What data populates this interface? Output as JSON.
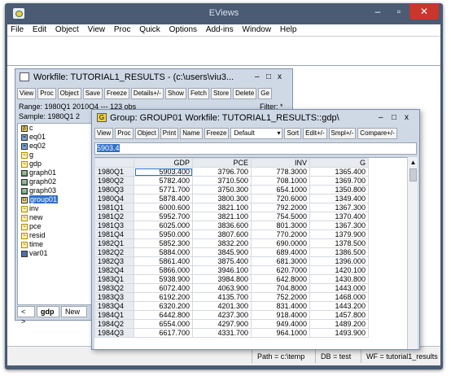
{
  "app": {
    "title": "EViews",
    "window_controls": {
      "minimize": "–",
      "maximize": "▫",
      "close": "✕"
    }
  },
  "menu": [
    "File",
    "Edit",
    "Object",
    "View",
    "Proc",
    "Quick",
    "Options",
    "Add-ins",
    "Window",
    "Help"
  ],
  "workfile_window": {
    "title": "Workfile: TUTORIAL1_RESULTS - (c:\\users\\viu3...",
    "controls": [
      "–",
      "□",
      "x"
    ],
    "toolbar": [
      "View",
      "Proc",
      "Object",
      "Save",
      "Freeze",
      "Details+/-",
      "Show",
      "Fetch",
      "Store",
      "Delete",
      "Ge"
    ],
    "range_label": "Range: 1980Q1 2010Q4  ---  123 obs",
    "range_right": "Filter: *",
    "sample_label": "Sample: 1980Q1 2",
    "objects": [
      {
        "name": "c",
        "icon": "coef-icon"
      },
      {
        "name": "eq01",
        "icon": "equation-icon"
      },
      {
        "name": "eq02",
        "icon": "equation-icon"
      },
      {
        "name": "g",
        "icon": "series-icon"
      },
      {
        "name": "gdp",
        "icon": "series-icon"
      },
      {
        "name": "graph01",
        "icon": "graph-icon"
      },
      {
        "name": "graph02",
        "icon": "graph-icon"
      },
      {
        "name": "graph03",
        "icon": "graph-icon"
      },
      {
        "name": "group01",
        "icon": "group-icon",
        "selected": true
      },
      {
        "name": "inv",
        "icon": "series-icon"
      },
      {
        "name": "new",
        "icon": "series-icon"
      },
      {
        "name": "pce",
        "icon": "series-icon"
      },
      {
        "name": "resid",
        "icon": "series-icon"
      },
      {
        "name": "time",
        "icon": "series-icon"
      },
      {
        "name": "var01",
        "icon": "var-icon"
      }
    ],
    "tabs": {
      "nav": "< >",
      "active": "gdp",
      "new": "New"
    }
  },
  "group_window": {
    "title": "Group: GROUP01   Workfile: TUTORIAL1_RESULTS::gdp\\",
    "controls": [
      "–",
      "□",
      "x"
    ],
    "toolbar": [
      "View",
      "Proc",
      "Object",
      "Print",
      "Name",
      "Freeze",
      "Sort",
      "Edit+/-",
      "Smpl+/-",
      "Compare+/-"
    ],
    "format_select": "Default",
    "cell_value": "5903.4",
    "columns": [
      "",
      "GDP",
      "PCE",
      "INV",
      "G"
    ],
    "rows": [
      [
        "1980Q1",
        "5903.400",
        "3796.700",
        "778.3000",
        "1365.400"
      ],
      [
        "1980Q2",
        "5782.400",
        "3710.500",
        "708.1000",
        "1369.700"
      ],
      [
        "1980Q3",
        "5771.700",
        "3750.300",
        "654.1000",
        "1350.800"
      ],
      [
        "1980Q4",
        "5878.400",
        "3800.300",
        "720.6000",
        "1349.400"
      ],
      [
        "1981Q1",
        "6000.600",
        "3821.100",
        "792.2000",
        "1367.300"
      ],
      [
        "1981Q2",
        "5952.700",
        "3821.100",
        "754.5000",
        "1370.400"
      ],
      [
        "1981Q3",
        "6025.000",
        "3836.600",
        "801.3000",
        "1367.300"
      ],
      [
        "1981Q4",
        "5950.000",
        "3807.600",
        "770.2000",
        "1379.900"
      ],
      [
        "1982Q1",
        "5852.300",
        "3832.200",
        "690.0000",
        "1378.500"
      ],
      [
        "1982Q2",
        "5884.000",
        "3845.900",
        "689.4000",
        "1386.500"
      ],
      [
        "1982Q3",
        "5861.400",
        "3875.400",
        "681.3000",
        "1396.000"
      ],
      [
        "1982Q4",
        "5866.000",
        "3946.100",
        "620.7000",
        "1420.100"
      ],
      [
        "1983Q1",
        "5938.900",
        "3984.800",
        "642.8000",
        "1430.800"
      ],
      [
        "1983Q2",
        "6072.400",
        "4063.900",
        "704.8000",
        "1443.000"
      ],
      [
        "1983Q3",
        "6192.200",
        "4135.700",
        "752.2000",
        "1468.000"
      ],
      [
        "1983Q4",
        "6320.200",
        "4201.300",
        "831.4000",
        "1443.200"
      ],
      [
        "1984Q1",
        "6442.800",
        "4237.300",
        "918.4000",
        "1457.800"
      ],
      [
        "1984Q2",
        "6554.000",
        "4297.900",
        "949.4000",
        "1489.200"
      ],
      [
        "1984Q3",
        "6617.700",
        "4331.700",
        "964.1000",
        "1493.900"
      ]
    ]
  },
  "status": {
    "path": "Path = c:\\temp",
    "db": "DB = test",
    "wf": "WF = tutorial1_results"
  }
}
